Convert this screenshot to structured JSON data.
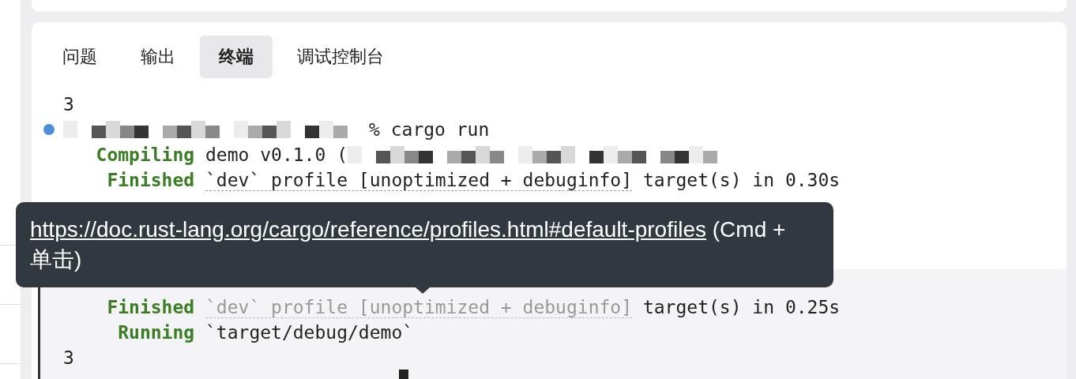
{
  "tabs": [
    {
      "label": "问题",
      "selected": false
    },
    {
      "label": "输出",
      "selected": false
    },
    {
      "label": "终端",
      "selected": true
    },
    {
      "label": "调试控制台",
      "selected": false
    }
  ],
  "terminal": {
    "blocks": [
      {
        "selected": false,
        "lines": [
          {
            "kind": "output",
            "text": "3"
          },
          {
            "kind": "prompt",
            "command": "% cargo run"
          },
          {
            "kind": "status",
            "status": "Compiling",
            "message": "demo v0.1.0 (",
            "redacted": true
          },
          {
            "kind": "status",
            "status": "Finished",
            "link": "`dev` profile [unoptimized + debuginfo]",
            "link_dimmed": false,
            "message": " target(s) in 0.30s"
          }
        ]
      },
      {
        "selected": true,
        "lines": [
          {
            "kind": "status",
            "status": "Finished",
            "link": "`dev` profile [unoptimized + debuginfo]",
            "link_dimmed": true,
            "message": " target(s) in 0.25s"
          },
          {
            "kind": "status",
            "status": "Running",
            "message": "`target/debug/demo`"
          },
          {
            "kind": "output",
            "text": "3"
          },
          {
            "kind": "cursor"
          }
        ]
      }
    ]
  },
  "tooltip": {
    "link": "https://doc.rust-lang.org/cargo/reference/profiles.html#default-profiles",
    "text": "(Cmd + 单击)"
  }
}
